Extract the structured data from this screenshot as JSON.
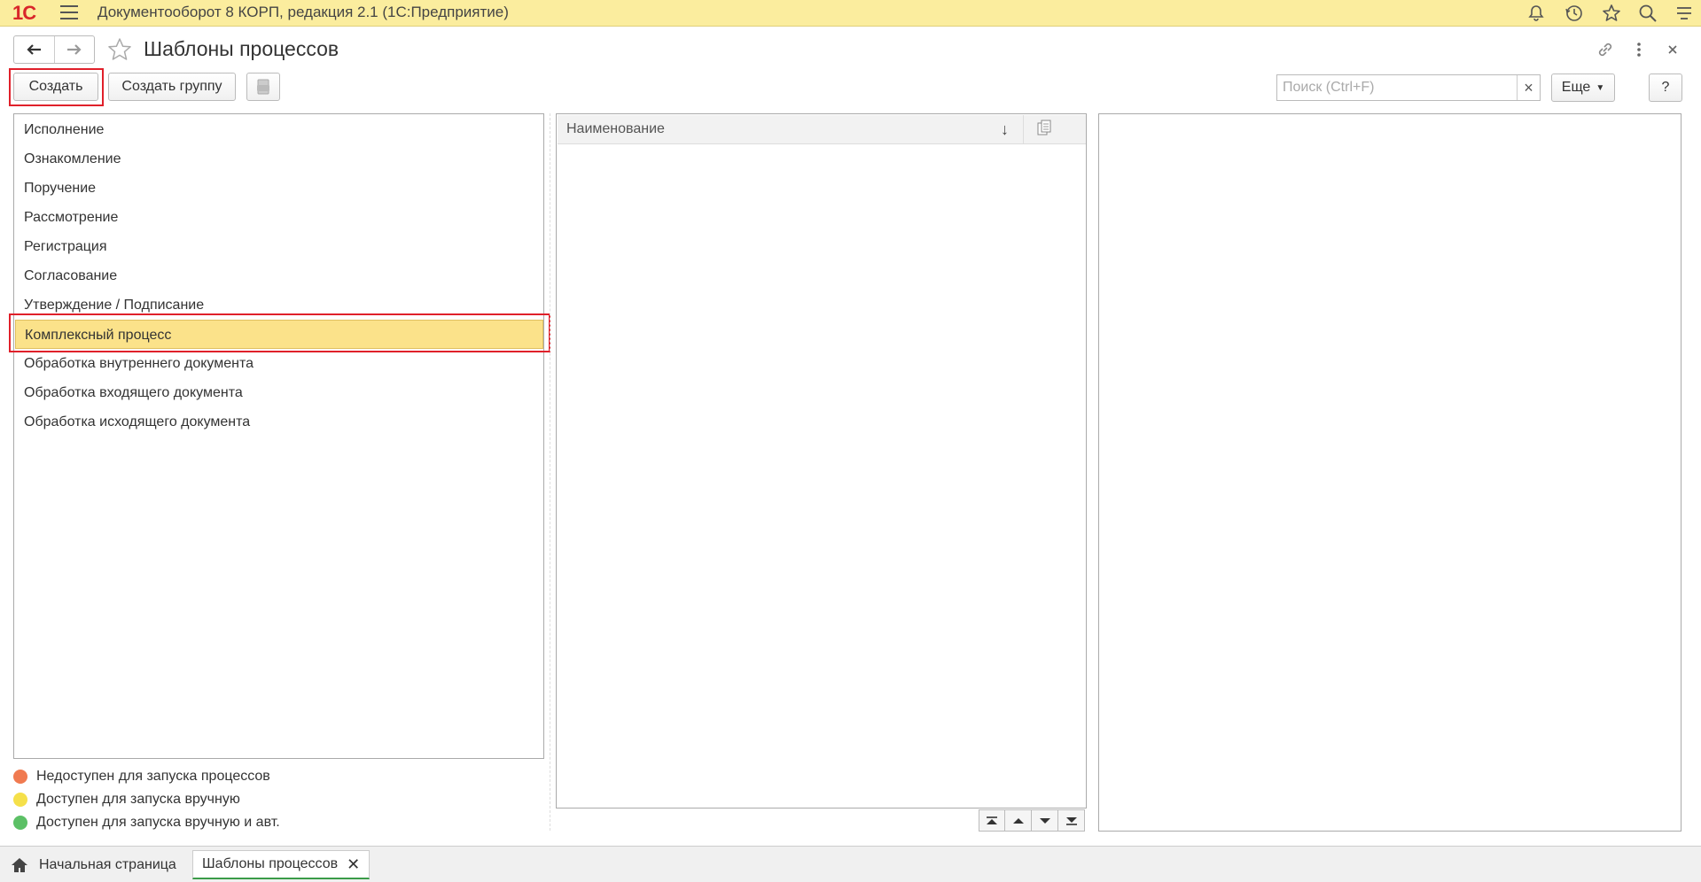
{
  "app": {
    "title": "Документооборот 8 КОРП, редакция 2.1  (1С:Предприятие)",
    "logo_text": "1С"
  },
  "header": {
    "title": "Шаблоны процессов"
  },
  "toolbar": {
    "create_label": "Создать",
    "create_group_label": "Создать группу",
    "search_placeholder": "Поиск (Ctrl+F)",
    "more_label": "Еще",
    "help_label": "?"
  },
  "tree": {
    "items": [
      {
        "label": "Исполнение"
      },
      {
        "label": "Ознакомление"
      },
      {
        "label": "Поручение"
      },
      {
        "label": "Рассмотрение"
      },
      {
        "label": "Регистрация"
      },
      {
        "label": "Согласование"
      },
      {
        "label": "Утверждение / Подписание"
      },
      {
        "label": "Комплексный процесс",
        "selected": true
      },
      {
        "label": "Обработка внутреннего документа"
      },
      {
        "label": "Обработка входящего документа"
      },
      {
        "label": "Обработка исходящего документа"
      }
    ]
  },
  "legend": [
    {
      "label": "Недоступен для запуска процессов",
      "color": "#f07a50"
    },
    {
      "label": "Доступен для запуска вручную",
      "color": "#f5e04a"
    },
    {
      "label": "Доступен для запуска вручную и авт.",
      "color": "#5cc066"
    }
  ],
  "table": {
    "column_name": "Наименование"
  },
  "tabs": {
    "home_label": "Начальная страница",
    "current_label": "Шаблоны процессов"
  },
  "colors": {
    "titlebar": "#fbed9e",
    "selection": "#fbe28a",
    "highlight_border": "#e0202a",
    "active_tab_underline": "#3a9b48"
  }
}
